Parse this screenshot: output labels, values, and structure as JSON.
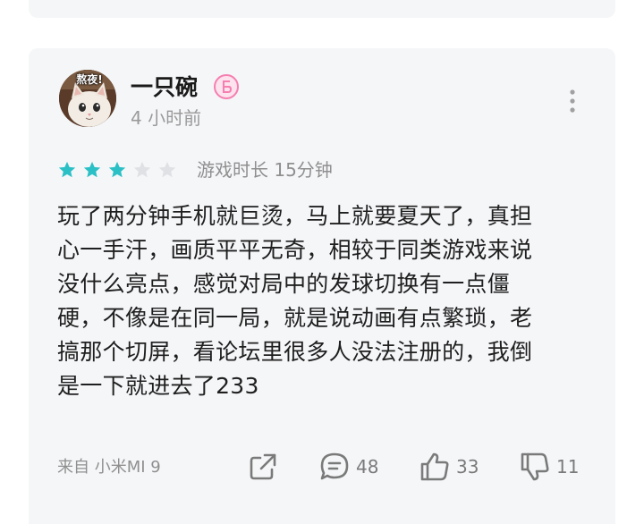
{
  "review": {
    "user": {
      "name": "一只碗",
      "avatar_caption": "熬夜!",
      "level_badge_icon": "level-badge-icon",
      "time_ago": "4 小时前"
    },
    "rating": {
      "filled": 3,
      "total": 5
    },
    "play_time": "游戏时长 15分钟",
    "content_lines": [
      "玩了两分钟手机就巨烫，马上就要夏天了，真担",
      "心一手汗，画质平平无奇，相较于同类游戏来说",
      "没什么亮点，感觉对局中的发球切换有一点僵",
      "硬，不像是在同一局，就是说动画有点繁琐，老",
      "搞那个切屏，看论坛里很多人没法注册的，我倒",
      "是一下就进去了233"
    ],
    "device": "来自 小米MI 9",
    "actions": {
      "share_icon": "share-icon",
      "comment_count": "48",
      "like_count": "33",
      "dislike_count": "11"
    }
  },
  "colors": {
    "star_filled": "#2ac0c6",
    "star_empty": "#dfe1e4",
    "card_bg": "#f5f6f8",
    "badge": "#f57fb0",
    "secondary_text": "#8f8f8f"
  }
}
